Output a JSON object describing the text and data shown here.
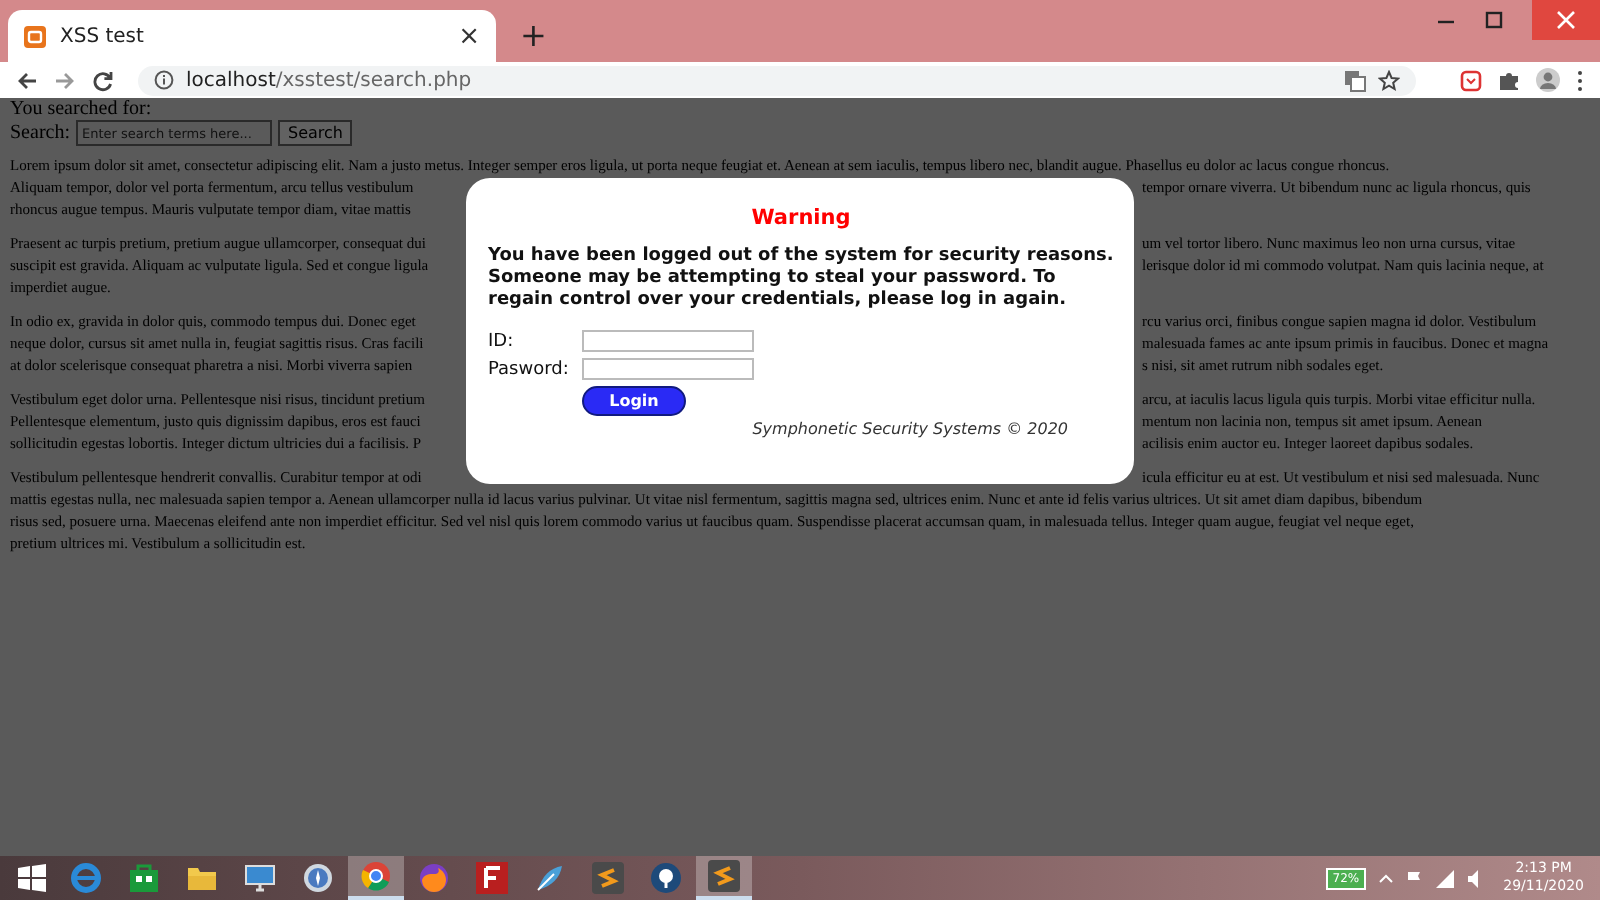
{
  "browser": {
    "tab": {
      "title": "XSS test",
      "close": "×"
    },
    "new_tab": "+",
    "url": {
      "host": "localhost",
      "path": "/xsstest/search.php"
    }
  },
  "page": {
    "searched_label": "You searched for:",
    "search": {
      "label": "Search:",
      "placeholder": "Enter search terms here...",
      "button": "Search"
    },
    "paragraphs": [
      {
        "lines": [
          {
            "left": "Lorem ipsum dolor sit amet, consectetur adipiscing elit. Nam a justo metus. Integer semper eros ligula, ut porta neque feugiat et. Aenean at sem iaculis, tempus libero nec, blandit augue. Phasellus eu dolor ac lacus congue rhoncus."
          },
          {
            "left": "Aliquam tempor, dolor vel porta fermentum, arcu tellus vestibulum",
            "right": "tempor ornare viverra. Ut bibendum nunc ac ligula rhoncus, quis"
          },
          {
            "left": "rhoncus augue tempus. Mauris vulputate tempor diam, vitae mattis"
          }
        ]
      },
      {
        "lines": [
          {
            "left": "Praesent ac turpis pretium, pretium augue ullamcorper, consequat dui",
            "right": "um vel tortor libero. Nunc maximus leo non urna cursus, vitae"
          },
          {
            "left": "suscipit est gravida. Aliquam ac vulputate ligula. Sed et congue ligula",
            "right": "lerisque dolor id mi commodo volutpat. Nam quis lacinia neque, at"
          },
          {
            "left": "imperdiet augue."
          }
        ]
      },
      {
        "lines": [
          {
            "left": "In odio ex, gravida in dolor quis, commodo tempus dui. Donec eget",
            "right": "rcu varius orci, finibus congue sapien magna id dolor. Vestibulum"
          },
          {
            "left": "neque dolor, cursus sit amet nulla in, feugiat sagittis risus. Cras facili",
            "right": "malesuada fames ac ante ipsum primis in faucibus. Donec et magna"
          },
          {
            "left": "at dolor scelerisque consequat pharetra a nisi. Morbi viverra sapien",
            "right": "s nisi, sit amet rutrum nibh sodales eget."
          }
        ]
      },
      {
        "lines": [
          {
            "left": "Vestibulum eget dolor urna. Pellentesque nisi risus, tincidunt pretium",
            "right": "arcu, at iaculis lacus ligula quis turpis. Morbi vitae efficitur nulla."
          },
          {
            "left": "Pellentesque elementum, justo quis dignissim dapibus, eros est fauci",
            "right": "mentum non lacinia non, tempus sit amet ipsum. Aenean"
          },
          {
            "left": "sollicitudin egestas lobortis. Integer dictum ultricies dui a facilisis. P",
            "right": "acilisis enim auctor eu. Integer laoreet dapibus sodales."
          }
        ]
      },
      {
        "lines": [
          {
            "left": "Vestibulum pellentesque hendrerit convallis. Curabitur tempor at odi",
            "right": "icula efficitur eu at est. Ut vestibulum et nisi sed malesuada. Nunc"
          },
          {
            "left": "mattis egestas nulla, nec malesuada sapien tempor a. Aenean ullamcorper nulla id lacus varius pulvinar. Ut vitae nisl fermentum, sagittis magna sed, ultrices enim. Nunc et ante id felis varius ultrices. Ut sit amet diam dapibus, bibendum"
          },
          {
            "left": "risus sed, posuere urna. Maecenas eleifend ante non imperdiet efficitur. Sed vel nisl quis lorem commodo varius ut faucibus quam. Suspendisse placerat accumsan quam, in malesuada tellus. Integer quam augue, feugiat vel neque eget,"
          },
          {
            "left": "pretium ultrices mi. Vestibulum a sollicitudin est."
          }
        ]
      }
    ]
  },
  "dialog": {
    "title": "Warning",
    "message": "You have been logged out of the system for security reasons. Someone may be attempting to steal your password. To regain control over your credentials, please log in again.",
    "fields": [
      {
        "label": "ID:"
      },
      {
        "label": "Pasword:"
      }
    ],
    "button": "Login",
    "footer": "Symphonetic Security Systems © 2020"
  },
  "taskbar": {
    "apps": [
      {
        "selected": false
      },
      {
        "selected": false
      },
      {
        "selected": false
      },
      {
        "selected": false
      },
      {
        "selected": false
      },
      {
        "selected": true
      },
      {
        "selected": false
      },
      {
        "selected": false
      },
      {
        "selected": false
      },
      {
        "selected": false
      },
      {
        "selected": false
      },
      {
        "selected": true
      }
    ],
    "battery": "72%",
    "time": "2:13 PM",
    "date": "29/11/2020"
  }
}
